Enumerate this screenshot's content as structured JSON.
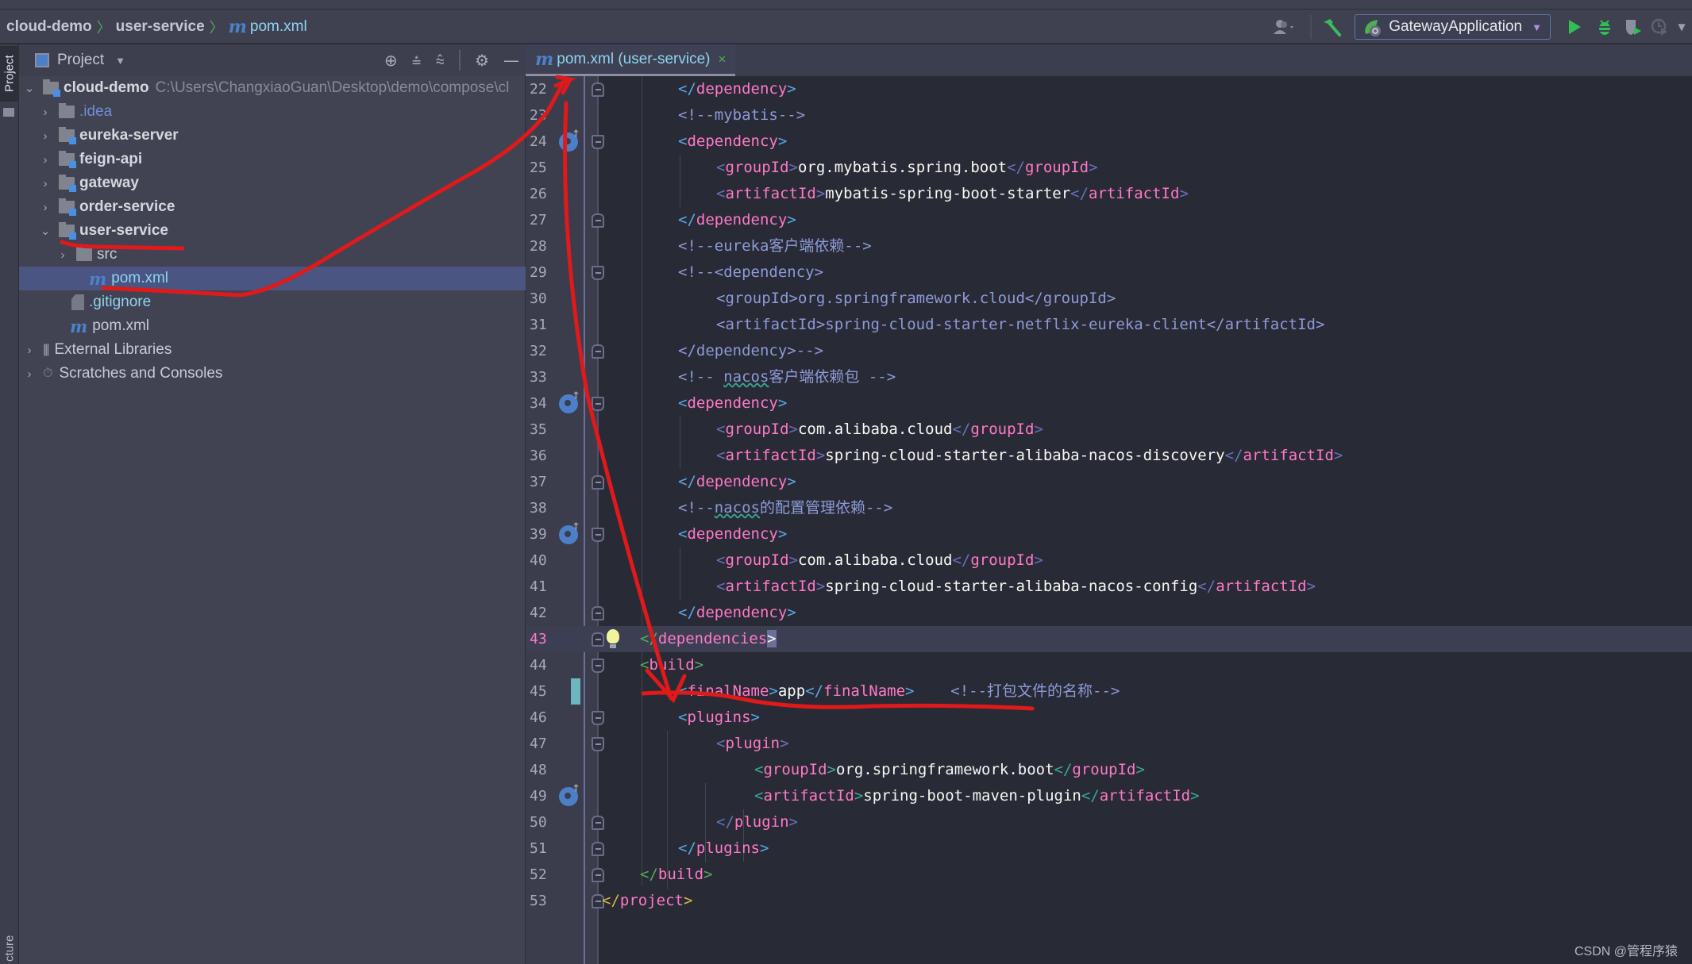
{
  "breadcrumb": {
    "items": [
      "cloud-demo",
      "user-service",
      "pom.xml"
    ],
    "file_icon": "m"
  },
  "toolbar": {
    "run_config": "GatewayApplication"
  },
  "left_strip": {
    "project_tab": "Project",
    "structure_tab": "cture"
  },
  "project_panel": {
    "title": "Project",
    "tree": [
      {
        "label": "cloud-demo",
        "path": "C:\\Users\\ChangxiaoGuan\\Desktop\\demo\\compose\\cl",
        "level": 0,
        "expanded": true,
        "type": "module"
      },
      {
        "label": ".idea",
        "level": 1,
        "expanded": false,
        "type": "folder"
      },
      {
        "label": "eureka-server",
        "level": 1,
        "expanded": false,
        "type": "module"
      },
      {
        "label": "feign-api",
        "level": 1,
        "expanded": false,
        "type": "module"
      },
      {
        "label": "gateway",
        "level": 1,
        "expanded": false,
        "type": "module"
      },
      {
        "label": "order-service",
        "level": 1,
        "expanded": false,
        "type": "module"
      },
      {
        "label": "user-service",
        "level": 1,
        "expanded": true,
        "type": "module"
      },
      {
        "label": "src",
        "level": 2,
        "expanded": false,
        "type": "folder"
      },
      {
        "label": "pom.xml",
        "level": 2,
        "type": "maven",
        "selected": true
      },
      {
        "label": ".gitignore",
        "level": 1,
        "type": "gitignore"
      },
      {
        "label": "pom.xml",
        "level": 1,
        "type": "maven"
      },
      {
        "label": "External Libraries",
        "level": 0,
        "expanded": false,
        "type": "libraries"
      },
      {
        "label": "Scratches and Consoles",
        "level": 0,
        "expanded": false,
        "type": "scratches"
      }
    ]
  },
  "editor": {
    "tab": {
      "label": "pom.xml (user-service)",
      "close": "×"
    },
    "current_line": 43,
    "lines": [
      {
        "n": "22",
        "text": "</dependency>"
      },
      {
        "n": "23",
        "text": "<!--mybatis-->"
      },
      {
        "n": "24",
        "text": "<dependency>"
      },
      {
        "n": "25",
        "text": "<groupId>org.mybatis.spring.boot</groupId>"
      },
      {
        "n": "26",
        "text": "<artifactId>mybatis-spring-boot-starter</artifactId>"
      },
      {
        "n": "27",
        "text": "</dependency>"
      },
      {
        "n": "28",
        "text": "<!--eureka客户端依赖-->"
      },
      {
        "n": "29",
        "text": "<!--<dependency>"
      },
      {
        "n": "30",
        "text": "<groupId>org.springframework.cloud</groupId>"
      },
      {
        "n": "31",
        "text": "<artifactId>spring-cloud-starter-netflix-eureka-client</artifactId>"
      },
      {
        "n": "32",
        "text": "</dependency>-->"
      },
      {
        "n": "33",
        "text": "<!-- nacos客户端依赖包 -->"
      },
      {
        "n": "34",
        "text": "<dependency>"
      },
      {
        "n": "35",
        "text": "<groupId>com.alibaba.cloud</groupId>"
      },
      {
        "n": "36",
        "text": "<artifactId>spring-cloud-starter-alibaba-nacos-discovery</artifactId>"
      },
      {
        "n": "37",
        "text": "</dependency>"
      },
      {
        "n": "38",
        "text": "<!--nacos的配置管理依赖-->"
      },
      {
        "n": "39",
        "text": "<dependency>"
      },
      {
        "n": "40",
        "text": "<groupId>com.alibaba.cloud</groupId>"
      },
      {
        "n": "41",
        "text": "<artifactId>spring-cloud-starter-alibaba-nacos-config</artifactId>"
      },
      {
        "n": "42",
        "text": "</dependency>"
      },
      {
        "n": "43",
        "text": "</dependencies>"
      },
      {
        "n": "44",
        "text": "<build>"
      },
      {
        "n": "45",
        "text": "<finalName>app</finalName>    <!--打包文件的名称-->"
      },
      {
        "n": "46",
        "text": "<plugins>"
      },
      {
        "n": "47",
        "text": "<plugin>"
      },
      {
        "n": "48",
        "text": "<groupId>org.springframework.boot</groupId>"
      },
      {
        "n": "49",
        "text": "<artifactId>spring-boot-maven-plugin</artifactId>"
      },
      {
        "n": "50",
        "text": "</plugin>"
      },
      {
        "n": "51",
        "text": "</plugins>"
      },
      {
        "n": "52",
        "text": "</build>"
      },
      {
        "n": "53",
        "text": "</project>"
      }
    ],
    "tokens": {
      "l22": [
        "</",
        "dependency",
        ">"
      ],
      "l23": "<!--mybatis-->",
      "l24": [
        "<",
        "dependency",
        ">"
      ],
      "l25": [
        "<",
        "groupId",
        ">",
        "org.mybatis.spring.boot",
        "</",
        "groupId",
        ">"
      ],
      "l26": [
        "<",
        "artifactId",
        ">",
        "mybatis-spring-boot-starter",
        "</",
        "artifactId",
        ">"
      ],
      "l27": [
        "</",
        "dependency",
        ">"
      ],
      "l28": "<!--eureka客户端依赖-->",
      "l29": "<!--<dependency>",
      "l30": "<groupId>org.springframework.cloud</groupId>",
      "l31": "<artifactId>spring-cloud-starter-netflix-eureka-client</artifactId>",
      "l32": "</dependency>-->",
      "l33a": "<!-- ",
      "l33b": "nacos",
      "l33c": "客户端依赖包 -->",
      "l34": [
        "<",
        "dependency",
        ">"
      ],
      "l35": [
        "<",
        "groupId",
        ">",
        "com.alibaba.cloud",
        "</",
        "groupId",
        ">"
      ],
      "l36": [
        "<",
        "artifactId",
        ">",
        "spring-cloud-starter-alibaba-nacos-discovery",
        "</",
        "artifactId",
        ">"
      ],
      "l37": [
        "</",
        "dependency",
        ">"
      ],
      "l38a": "<!--",
      "l38b": "nacos",
      "l38c": "的配置管理依赖-->",
      "l39": [
        "<",
        "dependency",
        ">"
      ],
      "l40": [
        "<",
        "groupId",
        ">",
        "com.alibaba.cloud",
        "</",
        "groupId",
        ">"
      ],
      "l41": [
        "<",
        "artifactId",
        ">",
        "spring-cloud-starter-alibaba-nacos-config",
        "</",
        "artifactId",
        ">"
      ],
      "l42": [
        "</",
        "dependency",
        ">"
      ],
      "l43": [
        "</",
        "dependencies",
        ">"
      ],
      "l44": [
        "<",
        "build",
        ">"
      ],
      "l45": [
        "<",
        "finalName",
        ">",
        "app",
        "</",
        "finalName",
        ">",
        "<!--打包文件的名称-->"
      ],
      "l46": [
        "<",
        "plugins",
        ">"
      ],
      "l47": [
        "<",
        "plugin",
        ">"
      ],
      "l48": [
        "<",
        "groupId",
        ">",
        "org.springframework.boot",
        "</",
        "groupId",
        ">"
      ],
      "l49": [
        "<",
        "artifactId",
        ">",
        "spring-boot-maven-plugin",
        "</",
        "artifactId",
        ">"
      ],
      "l50": [
        "</",
        "plugin",
        ">"
      ],
      "l51": [
        "</",
        "plugins",
        ">"
      ],
      "l52": [
        "</",
        "build",
        ">"
      ],
      "l53": [
        "</",
        "project",
        ">"
      ]
    }
  },
  "watermark": "CSDN @管程序猿",
  "colors": {
    "editor_bg": "#282a36",
    "tag_name": "#ff79c6",
    "comment": "#8d9ad6",
    "selection": "#4b5581",
    "annotation": "#e0191b"
  }
}
